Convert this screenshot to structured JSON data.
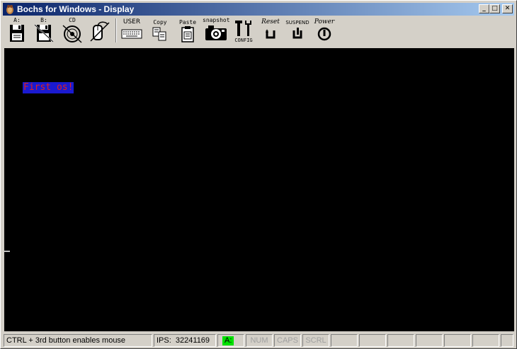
{
  "window": {
    "title": "Bochs for Windows - Display",
    "min_glyph": "_",
    "max_glyph": "□",
    "close_glyph": "✕"
  },
  "toolbar": {
    "floppy_a": "A:",
    "floppy_b": "B:",
    "cdrom": "CD",
    "user": "USER",
    "copy": "Copy",
    "paste": "Paste",
    "snapshot": "snapshot",
    "config": "CONFIG",
    "reset": "Reset",
    "suspend": "SUSPEND",
    "power": "Power"
  },
  "display": {
    "text": "First os!",
    "text_fg": "#e0201f",
    "text_bg": "#1a1ad0"
  },
  "status": {
    "message": "CTRL + 3rd button enables mouse",
    "ips_label": "IPS:",
    "ips_value": "32241169",
    "drive": "A:",
    "num": "NUM",
    "caps": "CAPS",
    "scrl": "SCRL"
  },
  "colors": {
    "title_start": "#0a246a",
    "title_end": "#a6caf0",
    "led_green": "#00e000"
  }
}
